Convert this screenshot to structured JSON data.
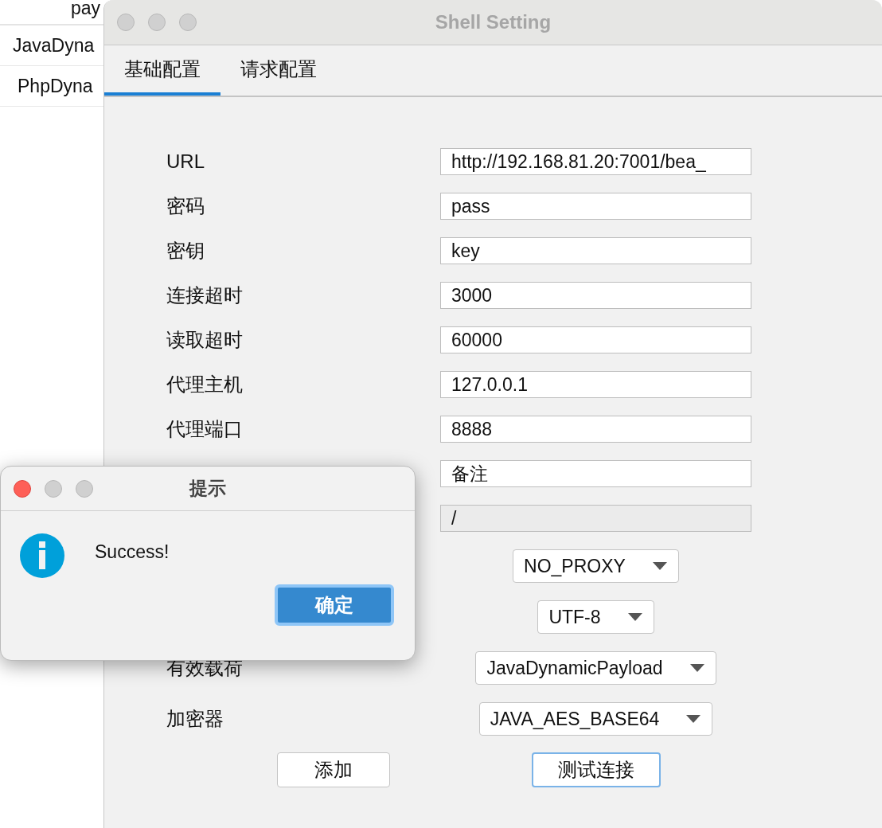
{
  "background_table": {
    "header": "pay",
    "rows": [
      "JavaDyna",
      "PhpDyna"
    ]
  },
  "window": {
    "title": "Shell Setting"
  },
  "tabs": [
    {
      "label": "基础配置",
      "selected": true
    },
    {
      "label": "请求配置",
      "selected": false
    }
  ],
  "fields": [
    {
      "kind": "text",
      "label": "URL",
      "value": "http://192.168.81.20:7001/bea_"
    },
    {
      "kind": "text",
      "label": "密码",
      "value": "pass"
    },
    {
      "kind": "text",
      "label": "密钥",
      "value": "key"
    },
    {
      "kind": "text",
      "label": "连接超时",
      "value": "3000"
    },
    {
      "kind": "text",
      "label": "读取超时",
      "value": "60000"
    },
    {
      "kind": "text",
      "label": "代理主机",
      "value": "127.0.0.1"
    },
    {
      "kind": "text",
      "label": "代理端口",
      "value": "8888"
    },
    {
      "kind": "text",
      "value": "备注"
    },
    {
      "kind": "readonly",
      "value": "/"
    },
    {
      "kind": "select",
      "value": "NO_PROXY"
    },
    {
      "kind": "select",
      "value": "UTF-8"
    },
    {
      "kind": "select",
      "label": "有效载荷",
      "value": "JavaDynamicPayload"
    },
    {
      "kind": "select",
      "label": "加密器",
      "value": "JAVA_AES_BASE64"
    }
  ],
  "buttons": [
    {
      "label": "添加",
      "focused": false
    },
    {
      "label": "测试连接",
      "focused": true
    }
  ],
  "dialog": {
    "title": "提示",
    "message": "Success!",
    "button": "确定"
  }
}
